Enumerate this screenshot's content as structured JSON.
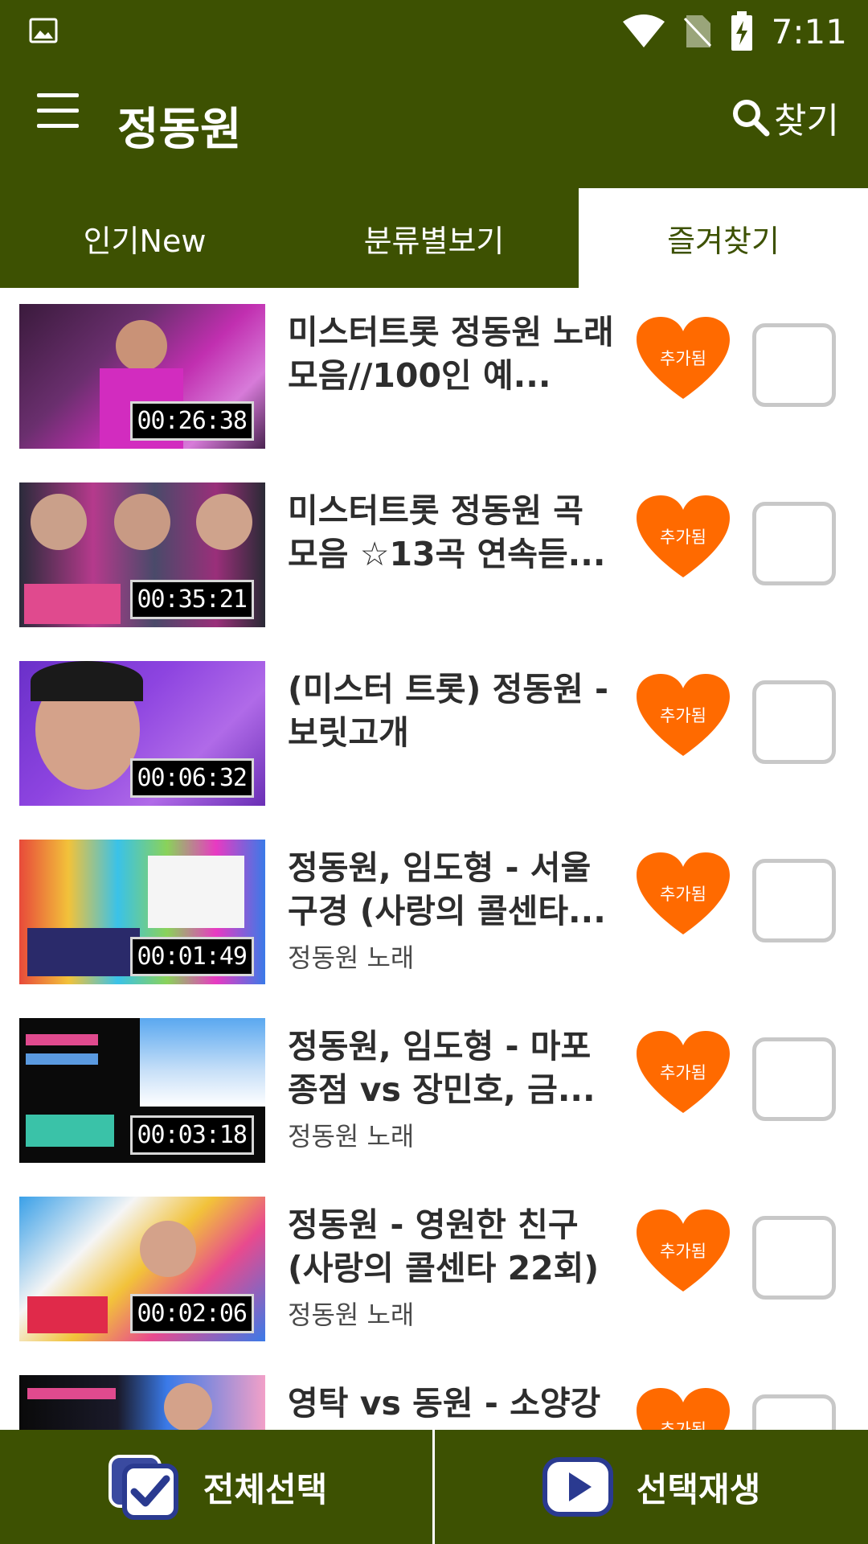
{
  "status_bar": {
    "time": "7:11"
  },
  "app_bar": {
    "title": "정동원",
    "search_label": "찾기"
  },
  "tabs": [
    {
      "label": "인기New",
      "active": false
    },
    {
      "label": "분류별보기",
      "active": false
    },
    {
      "label": "즐겨찾기",
      "active": true
    }
  ],
  "videos": [
    {
      "title": "미스터트롯 정동원 노래 모음//100인 예...",
      "subtitle": "",
      "duration": "00:26:38",
      "favorite_label": "추가됨"
    },
    {
      "title": "미스터트롯 정동원 곡 모음 ☆13곡 연속듣...",
      "subtitle": "",
      "duration": "00:35:21",
      "favorite_label": "추가됨"
    },
    {
      "title": "(미스터 트롯) 정동원 - 보릿고개",
      "subtitle": "",
      "duration": "00:06:32",
      "favorite_label": "추가됨"
    },
    {
      "title": "정동원, 임도형 - 서울 구경 (사랑의 콜센타...",
      "subtitle": "정동원 노래",
      "duration": "00:01:49",
      "favorite_label": "추가됨"
    },
    {
      "title": "정동원, 임도형 - 마포 종점 vs 장민호, 금...",
      "subtitle": "정동원 노래",
      "duration": "00:03:18",
      "favorite_label": "추가됨"
    },
    {
      "title": "정동원 - 영원한 친구 (사랑의 콜센타 22회)",
      "subtitle": "정동원 노래",
      "duration": "00:02:06",
      "favorite_label": "추가됨"
    },
    {
      "title": "영탁 vs 동원 - 소양강",
      "subtitle": "",
      "duration": "",
      "favorite_label": "추가됨"
    }
  ],
  "bottom_bar": {
    "select_all_label": "전체선택",
    "play_selected_label": "선택재생"
  },
  "colors": {
    "primary": "#3d5102",
    "heart": "#ff6a00",
    "checkbox_border": "#c8c8c8"
  }
}
